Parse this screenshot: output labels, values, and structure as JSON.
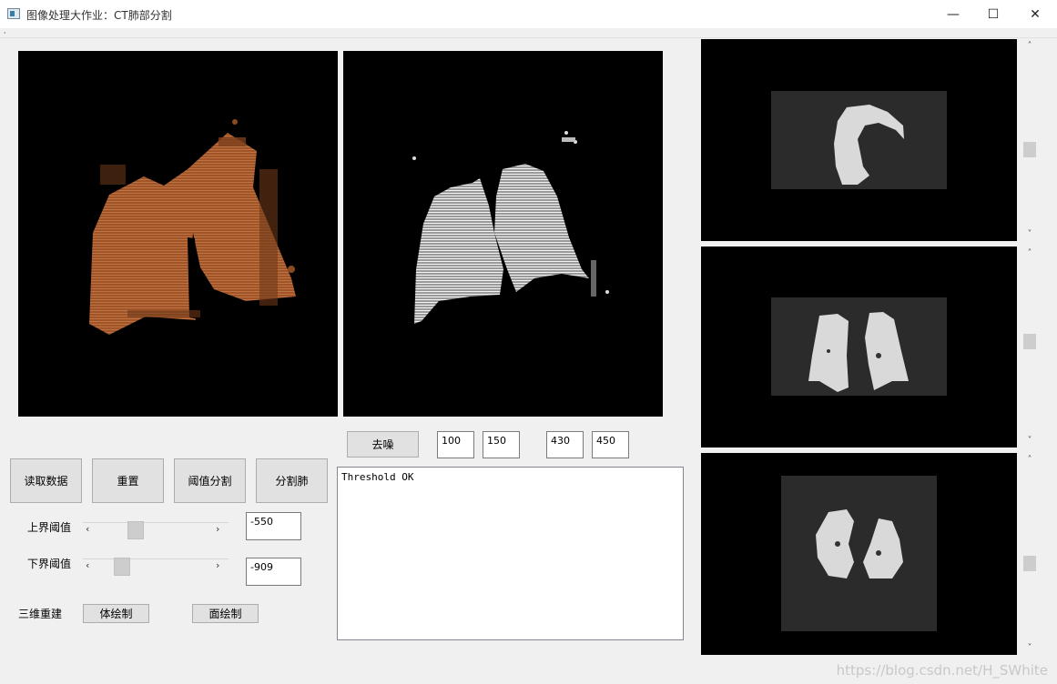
{
  "window": {
    "title": "图像处理大作业：CT肺部分割",
    "minimize_glyph": "—",
    "maximize_glyph": "☐",
    "close_glyph": "✕"
  },
  "menu": {
    "marker": ","
  },
  "views": {
    "volume_render": {
      "icon": "lung-volume-render",
      "color": "#b0622e"
    },
    "surface_render": {
      "icon": "lung-surface-render",
      "color": "#e8e8e8"
    }
  },
  "controls": {
    "denoise_label": "去噪",
    "fields": [
      "100",
      "150",
      "430",
      "450"
    ],
    "read_label": "读取数据",
    "reset_label": "重置",
    "threshold_label": "阈值分割",
    "segment_label": "分割肺",
    "upper_label": "上界阈值",
    "lower_label": "下界阈值",
    "upper_value": "-550",
    "lower_value": "-909",
    "upper_slider_fraction": 0.32,
    "lower_slider_fraction": 0.2,
    "slider_left": "‹",
    "slider_right": "›",
    "recon_label": "三维重建",
    "volume_btn": "体绘制",
    "surface_btn": "面绘制"
  },
  "log": {
    "text": "Threshold OK"
  },
  "slices": {
    "scroll_up": "˄",
    "scroll_down": "˅",
    "colors": {
      "bg": "#2b2b2b",
      "lung": "#d9d9d9"
    }
  },
  "watermark": "https://blog.csdn.net/H_SWhite"
}
